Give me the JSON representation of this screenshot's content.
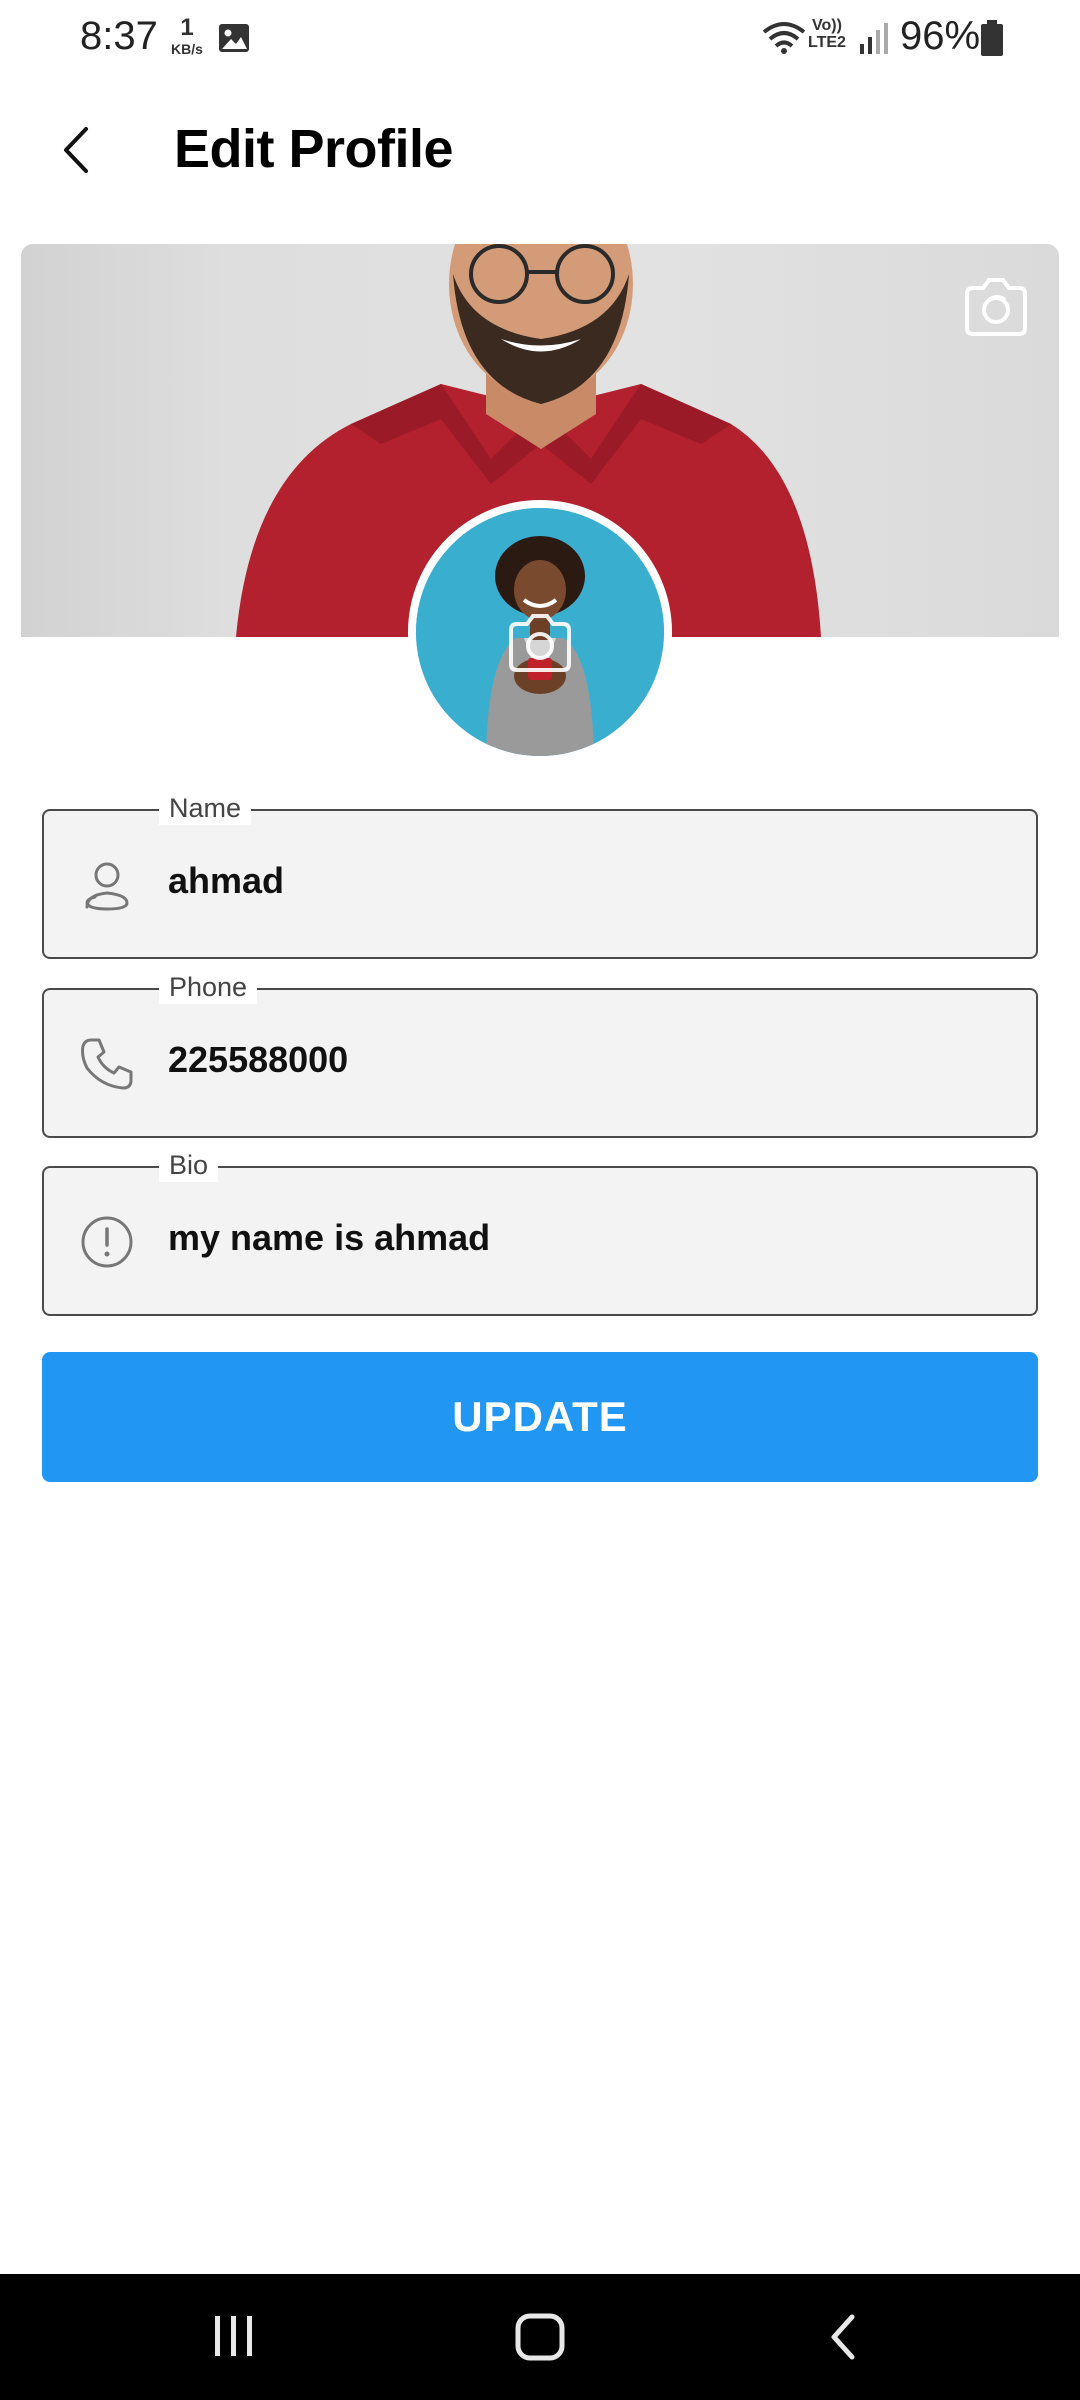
{
  "status_bar": {
    "time": "8:37",
    "net_speed_value": "1",
    "net_speed_unit": "KB/s",
    "volte_line1": "Vo))",
    "volte_line2": "LTE2",
    "battery_percent": "96%"
  },
  "header": {
    "title": "Edit Profile"
  },
  "profile": {
    "cover_photo": "man-red-polo-photo",
    "avatar_photo": "person-with-phone-photo"
  },
  "form": {
    "name": {
      "label": "Name",
      "value": "ahmad",
      "icon": "person-icon"
    },
    "phone": {
      "label": "Phone",
      "value": "225588000",
      "icon": "phone-icon"
    },
    "bio": {
      "label": "Bio",
      "value": "my name is ahmad",
      "icon": "info-icon"
    }
  },
  "actions": {
    "update_label": "UPDATE"
  },
  "colors": {
    "primary": "#2196f3",
    "field_bg": "#f3f3f3",
    "field_border": "#4a4a4a"
  }
}
